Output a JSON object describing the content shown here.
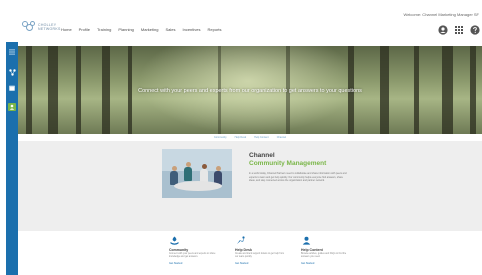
{
  "header": {
    "welcome": "Welcome: Channel Marketing Manager SF",
    "logo_text_top": "CHOLLEY",
    "logo_text_bottom": "NETWORKS"
  },
  "nav": {
    "items": [
      "Home",
      "Profile",
      "Training",
      "Planning",
      "Marketing",
      "Sales",
      "Incentives",
      "Reports"
    ]
  },
  "top_icons": [
    "user-icon",
    "grid-icon",
    "help-icon"
  ],
  "sidebar": {
    "icons": [
      "menu-icon",
      "nodes-icon",
      "calendar-icon",
      "person-icon"
    ]
  },
  "hero": {
    "text": "Connect with your peers and experts from our organization to get answers to your questions"
  },
  "subtabs": [
    "Community",
    "Help Desk",
    "Help Content",
    "Channel"
  ],
  "community": {
    "title_line1": "Channel",
    "title_line2": "Community Management",
    "body": "In a world today, Channel Partners need to collaborate and share information with peers and experts to learn and get help quickly. Our community helps everyone find answers, share ideas, and stay connected across the organization and partner network."
  },
  "cards": [
    {
      "icon": "community-icon",
      "title": "Community",
      "desc": "Connect with your peers and experts to share knowledge and get answers.",
      "link": "Get Started"
    },
    {
      "icon": "help-desk-icon",
      "title": "Help Desk",
      "desc": "Create and track support tickets to get help from our team quickly.",
      "link": "Get Started"
    },
    {
      "icon": "help-content-icon",
      "title": "Help Content",
      "desc": "Browse articles, guides and FAQs to find the answers you need.",
      "link": "Get Started"
    }
  ],
  "colors": {
    "brand_blue": "#1b6fad",
    "accent_green": "#7ab648",
    "band_gray": "#eeeeee"
  }
}
